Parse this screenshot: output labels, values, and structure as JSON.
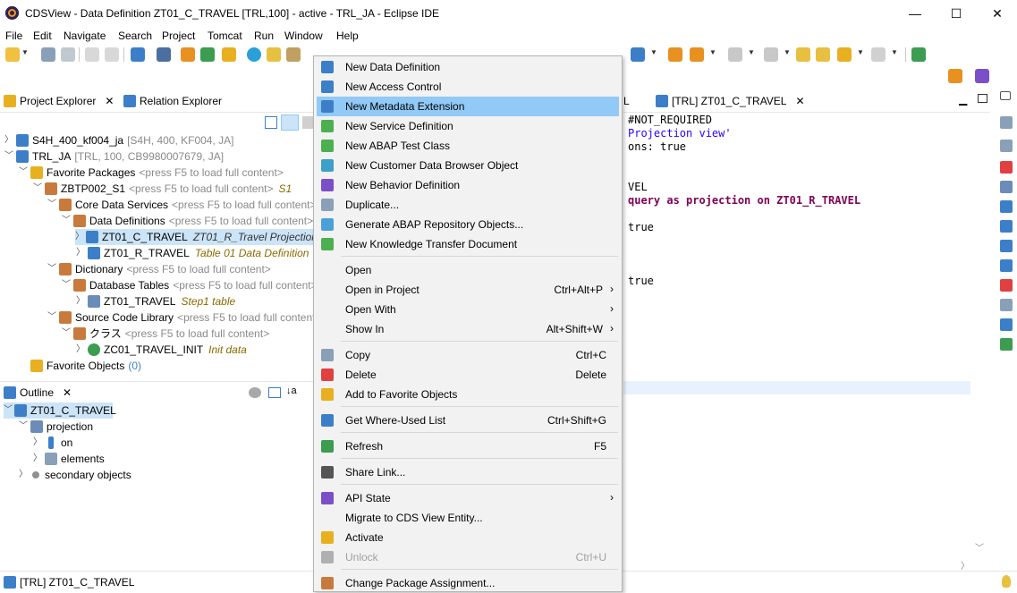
{
  "window": {
    "title": "CDSView - Data Definition ZT01_C_TRAVEL [TRL,100] - active - TRL_JA - Eclipse IDE",
    "minimize": "—",
    "maximize": "☐",
    "close": "✕"
  },
  "menubar": [
    "File",
    "Edit",
    "Navigate",
    "Search",
    "Project",
    "Tomcat",
    "Run",
    "Window",
    "Help"
  ],
  "project_explorer": {
    "tab_label": "Project Explorer",
    "relation_tab_label": "Relation Explorer",
    "tree": [
      {
        "label": "S4H_400_kf004_ja",
        "detail": "[S4H, 400, KF004, JA]"
      },
      {
        "label": "TRL_JA",
        "detail": "[TRL, 100, CB9980007679, JA]"
      },
      {
        "label": "Favorite Packages",
        "detail": "<press F5 to load full content>"
      },
      {
        "label": "ZBTP002_S1",
        "detail": "<press F5 to load full content>",
        "note": "S1"
      },
      {
        "label": "Core Data Services",
        "detail": "<press F5 to load full content>"
      },
      {
        "label": "Data Definitions",
        "detail": "<press F5 to load full content>"
      },
      {
        "label": "ZT01_C_TRAVEL",
        "note": "ZT01_R_Travel Projection v..."
      },
      {
        "label": "ZT01_R_TRAVEL",
        "note": "Table 01 Data Definition"
      },
      {
        "label": "Dictionary",
        "detail": "<press F5 to load full content>"
      },
      {
        "label": "Database Tables",
        "detail": "<press F5 to load full content>"
      },
      {
        "label": "ZT01_TRAVEL",
        "note": "Step1 table"
      },
      {
        "label": "Source Code Library",
        "detail": "<press F5 to load full content>"
      },
      {
        "label": "クラス",
        "detail": "<press F5 to load full content>"
      },
      {
        "label": "ZC01_TRAVEL_INIT",
        "note": "Init data"
      },
      {
        "label": "Favorite Objects",
        "detail": "(0)"
      }
    ]
  },
  "outline": {
    "tab_label": "Outline",
    "tree": [
      {
        "label": "ZT01_C_TRAVEL"
      },
      {
        "label": "projection"
      },
      {
        "label": "on"
      },
      {
        "label": "elements"
      },
      {
        "label": "secondary objects"
      }
    ]
  },
  "editor": {
    "hidden_tab_fragment": "L",
    "tab_label": "[TRL] ZT01_C_TRAVEL",
    "lines": [
      {
        "text": "#NOT_REQUIRED",
        "kind": "plain"
      },
      {
        "text": "Projection view'",
        "kind": "str"
      },
      {
        "text": "ons: true",
        "kind": "plain"
      },
      {
        "text": "VEL",
        "kind": "plain"
      },
      {
        "text": "query as projection on ZT01_R_TRAVEL",
        "kind": "kw"
      },
      {
        "text": "true",
        "kind": "plain"
      },
      {
        "text": "true",
        "kind": "plain"
      }
    ]
  },
  "context_menu": {
    "items": [
      {
        "label": "New Data Definition",
        "icon": "data-definition-icon",
        "color": "#3c7fc8"
      },
      {
        "label": "New Access Control",
        "icon": "access-control-icon",
        "color": "#3c7fc8"
      },
      {
        "label": "New Metadata Extension",
        "icon": "metadata-extension-icon",
        "color": "#3c7fc8",
        "highlighted": true
      },
      {
        "label": "New Service Definition",
        "icon": "service-definition-icon",
        "color": "#4caf50"
      },
      {
        "label": "New ABAP Test Class",
        "icon": "test-class-icon",
        "color": "#4caf50"
      },
      {
        "label": "New Customer Data Browser Object",
        "icon": "data-browser-icon",
        "color": "#3ca0c8"
      },
      {
        "label": "New Behavior Definition",
        "icon": "behavior-definition-icon",
        "color": "#7b4fc8"
      },
      {
        "label": "Duplicate...",
        "icon": "duplicate-icon",
        "color": "#8aa0b8"
      },
      {
        "label": "Generate ABAP Repository Objects...",
        "icon": "generate-icon",
        "color": "#4aa0d8"
      },
      {
        "label": "New Knowledge Transfer Document",
        "icon": "knowledge-doc-icon",
        "color": "#4caf50"
      },
      {
        "sep": true
      },
      {
        "label": "Open"
      },
      {
        "label": "Open in Project",
        "shortcut": "Ctrl+Alt+P",
        "submenu": true
      },
      {
        "label": "Open With",
        "submenu": true
      },
      {
        "label": "Show In",
        "shortcut": "Alt+Shift+W",
        "submenu": true
      },
      {
        "sep": true
      },
      {
        "label": "Copy",
        "shortcut": "Ctrl+C",
        "icon": "copy-icon",
        "color": "#8aa0b8"
      },
      {
        "label": "Delete",
        "shortcut": "Delete",
        "icon": "delete-icon",
        "color": "#e04040"
      },
      {
        "label": "Add to Favorite Objects",
        "icon": "star-icon",
        "color": "#e8b020"
      },
      {
        "sep": true
      },
      {
        "label": "Get Where-Used List",
        "shortcut": "Ctrl+Shift+G",
        "icon": "where-used-icon",
        "color": "#3c7fc8"
      },
      {
        "sep": true
      },
      {
        "label": "Refresh",
        "shortcut": "F5",
        "icon": "refresh-icon",
        "color": "#3c9c50"
      },
      {
        "sep": true
      },
      {
        "label": "Share Link...",
        "icon": "share-link-icon",
        "color": "#555555"
      },
      {
        "sep": true
      },
      {
        "label": "API State",
        "submenu": true,
        "icon": "gear-icon",
        "color": "#7b4fc8"
      },
      {
        "label": "Migrate to CDS View Entity..."
      },
      {
        "label": "Activate",
        "icon": "activate-icon",
        "color": "#e8b020"
      },
      {
        "label": "Unlock",
        "shortcut": "Ctrl+U",
        "disabled": true,
        "icon": "lock-icon",
        "color": "#b0b0b0"
      },
      {
        "sep": true
      },
      {
        "label": "Change Package Assignment...",
        "icon": "package-icon",
        "color": "#c87a3c"
      }
    ]
  },
  "status": {
    "text": "[TRL] ZT01_C_TRAVEL"
  },
  "colors": {
    "highlight": "#91c9f7",
    "selection": "#cce4f7",
    "keyword": "#7f0055",
    "string": "#2a00ff"
  }
}
